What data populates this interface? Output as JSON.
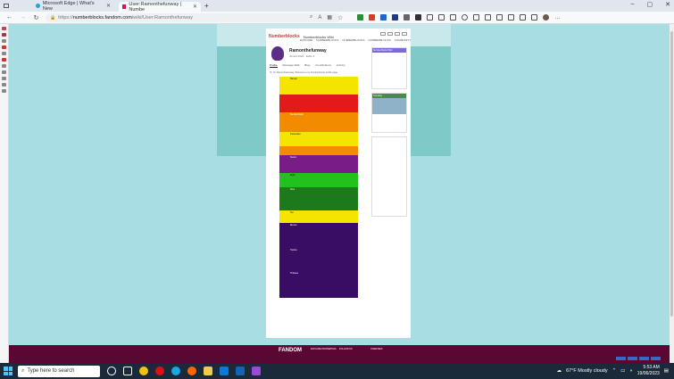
{
  "tabs": [
    {
      "label": "Microsoft Edge | What's New",
      "active": false
    },
    {
      "label": "User:Ramonthefunway | Numbe",
      "active": true
    }
  ],
  "address": {
    "prefix": "https://",
    "host": "numberblocks.fandom.com",
    "path": "/wiki/User:Ramonthefunway"
  },
  "wiki": {
    "logo": "Numberblocks",
    "name": "Numberblocks Wiki",
    "nav": [
      "EXPLORE",
      "NUMBERBLOCKS",
      "NUMBERBLOCKS",
      "NUMBERBLOCKS",
      "COMMUNITY"
    ],
    "user_name": "Ramonthefunway",
    "user_meta": "Joined 2022 · Edits 3",
    "edit_label": "Edit Profile",
    "profile_tabs": [
      "Profile",
      "Message Wall",
      "Blog",
      "Contributions",
      "Activity"
    ],
    "intro_text": "Hi, I'm Ramonthefunway. Welcome to my Numberblocks profile page."
  },
  "blocks": [
    {
      "color": "#f5e400",
      "dark": true,
      "text": "Ramon",
      "h": 20
    },
    {
      "color": "#e21a1a",
      "dark": false,
      "text": "",
      "h": 20
    },
    {
      "color": "#f28b00",
      "dark": false,
      "text": "Numberblock",
      "h": 22
    },
    {
      "color": "#f5e400",
      "dark": true,
      "text": "Favourites",
      "h": 16
    },
    {
      "color": "#f28b00",
      "dark": false,
      "text": "",
      "h": 10
    },
    {
      "color": "#7a1c87",
      "dark": false,
      "text": "Seven",
      "h": 20
    },
    {
      "color": "#22c21e",
      "dark": true,
      "text": "Eight",
      "h": 16
    },
    {
      "color": "#1d7a1b",
      "dark": false,
      "text": "Nine",
      "h": 26
    },
    {
      "color": "#f5e400",
      "dark": true,
      "text": "Ten",
      "h": 14
    },
    {
      "color": "#3a0d64",
      "dark": false,
      "text": "Eleven",
      "h": 28
    },
    {
      "color": "#3a0d64",
      "dark": false,
      "text": "Twelve",
      "h": 26
    },
    {
      "color": "#3a0d64",
      "dark": false,
      "text": "Thirteen",
      "h": 30
    }
  ],
  "right_rail": {
    "card1_title": "Numberblocks Wiki",
    "card2_title": "Trending"
  },
  "footer": {
    "logo": "FANDOM",
    "cols": [
      "EXPLORE PROPERTIES",
      "FOLLOW US",
      "OVERVIEW",
      "COMMUNITY"
    ]
  },
  "taskbar": {
    "search_placeholder": "Type here to search",
    "weather": "67°F  Mostly cloudy",
    "time": "5:53 AM",
    "date": "19/06/2023"
  }
}
